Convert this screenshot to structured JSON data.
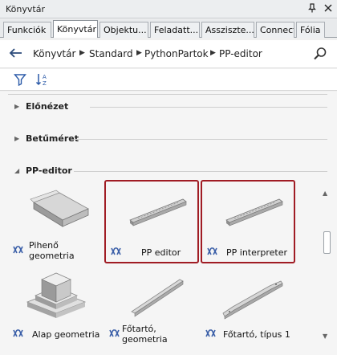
{
  "window": {
    "title": "Könyvtár",
    "pin": "❙",
    "close": "✕"
  },
  "tabs": [
    {
      "label": "Funkciók"
    },
    {
      "label": "Könyvtár"
    },
    {
      "label": "Objektu..."
    },
    {
      "label": "Feladatt..."
    },
    {
      "label": "Asszisztе..."
    },
    {
      "label": "Connect"
    },
    {
      "label": "Fólia"
    }
  ],
  "breadcrumb": [
    "Könyvtár",
    "Standard",
    "PythonPartok",
    "PP-editor"
  ],
  "sections": {
    "preview": "Előnézet",
    "fontsize": "Betűméret",
    "ppeditor": "PP-editor"
  },
  "items": [
    {
      "label": "Pihenő geometria"
    },
    {
      "label": "PP editor"
    },
    {
      "label": "PP interpreter"
    },
    {
      "label": "Alap geometria"
    },
    {
      "label": "Főtartó, geometria"
    },
    {
      "label": "Főtartó, típus 1"
    }
  ],
  "colors": {
    "accent": "#a01c24",
    "icon_blue": "#3b5fa8"
  }
}
